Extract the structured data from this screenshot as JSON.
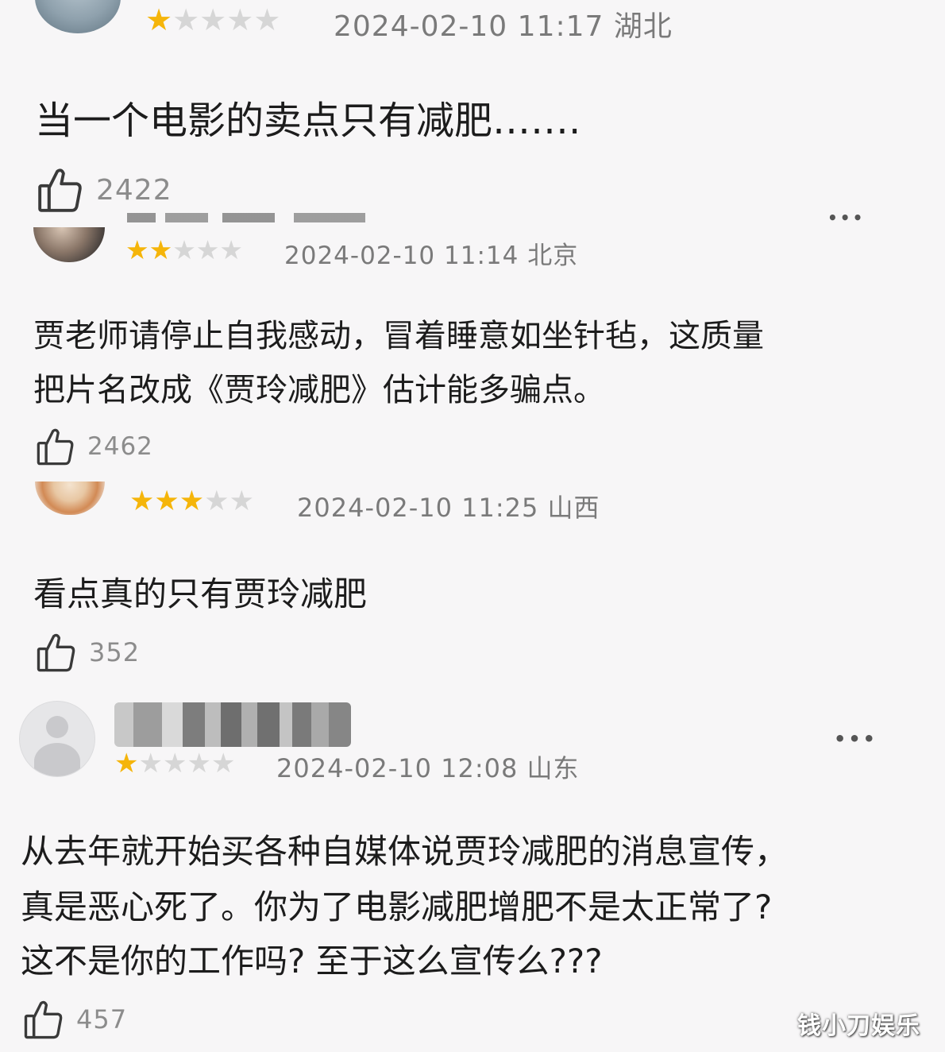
{
  "colors": {
    "star_on": "#f5b50a",
    "star_off": "#d6d6d6",
    "meta": "#7a7a7a"
  },
  "comments": [
    {
      "rating": 1,
      "date": "2024-02-10 11:17",
      "region": "湖北",
      "lines": [
        "当一个电影的卖点只有减肥……."
      ],
      "likes": "2422"
    },
    {
      "rating": 2,
      "date": "2024-02-10 11:14",
      "region": "北京",
      "lines": [
        "贾老师请停止自我感动，冒着睡意如坐针毡，这质量",
        "把片名改成《贾玲减肥》估计能多骗点。"
      ],
      "likes": "2462"
    },
    {
      "rating": 3,
      "date": "2024-02-10 11:25",
      "region": "山西",
      "lines": [
        "看点真的只有贾玲减肥"
      ],
      "likes": "352"
    },
    {
      "rating": 1,
      "date": "2024-02-10 12:08",
      "region": "山东",
      "more": "•••",
      "lines": [
        "从去年就开始买各种自媒体说贾玲减肥的消息宣传，",
        "真是恶心死了。你为了电影减肥增肥不是太正常了?",
        "这不是你的工作吗? 至于这么宣传么???"
      ],
      "likes": "457"
    }
  ],
  "watermark": "钱小刀娱乐",
  "icons": {
    "like": "thumbs-up-icon",
    "more": "more-dots-icon",
    "avatar": "user-avatar"
  }
}
